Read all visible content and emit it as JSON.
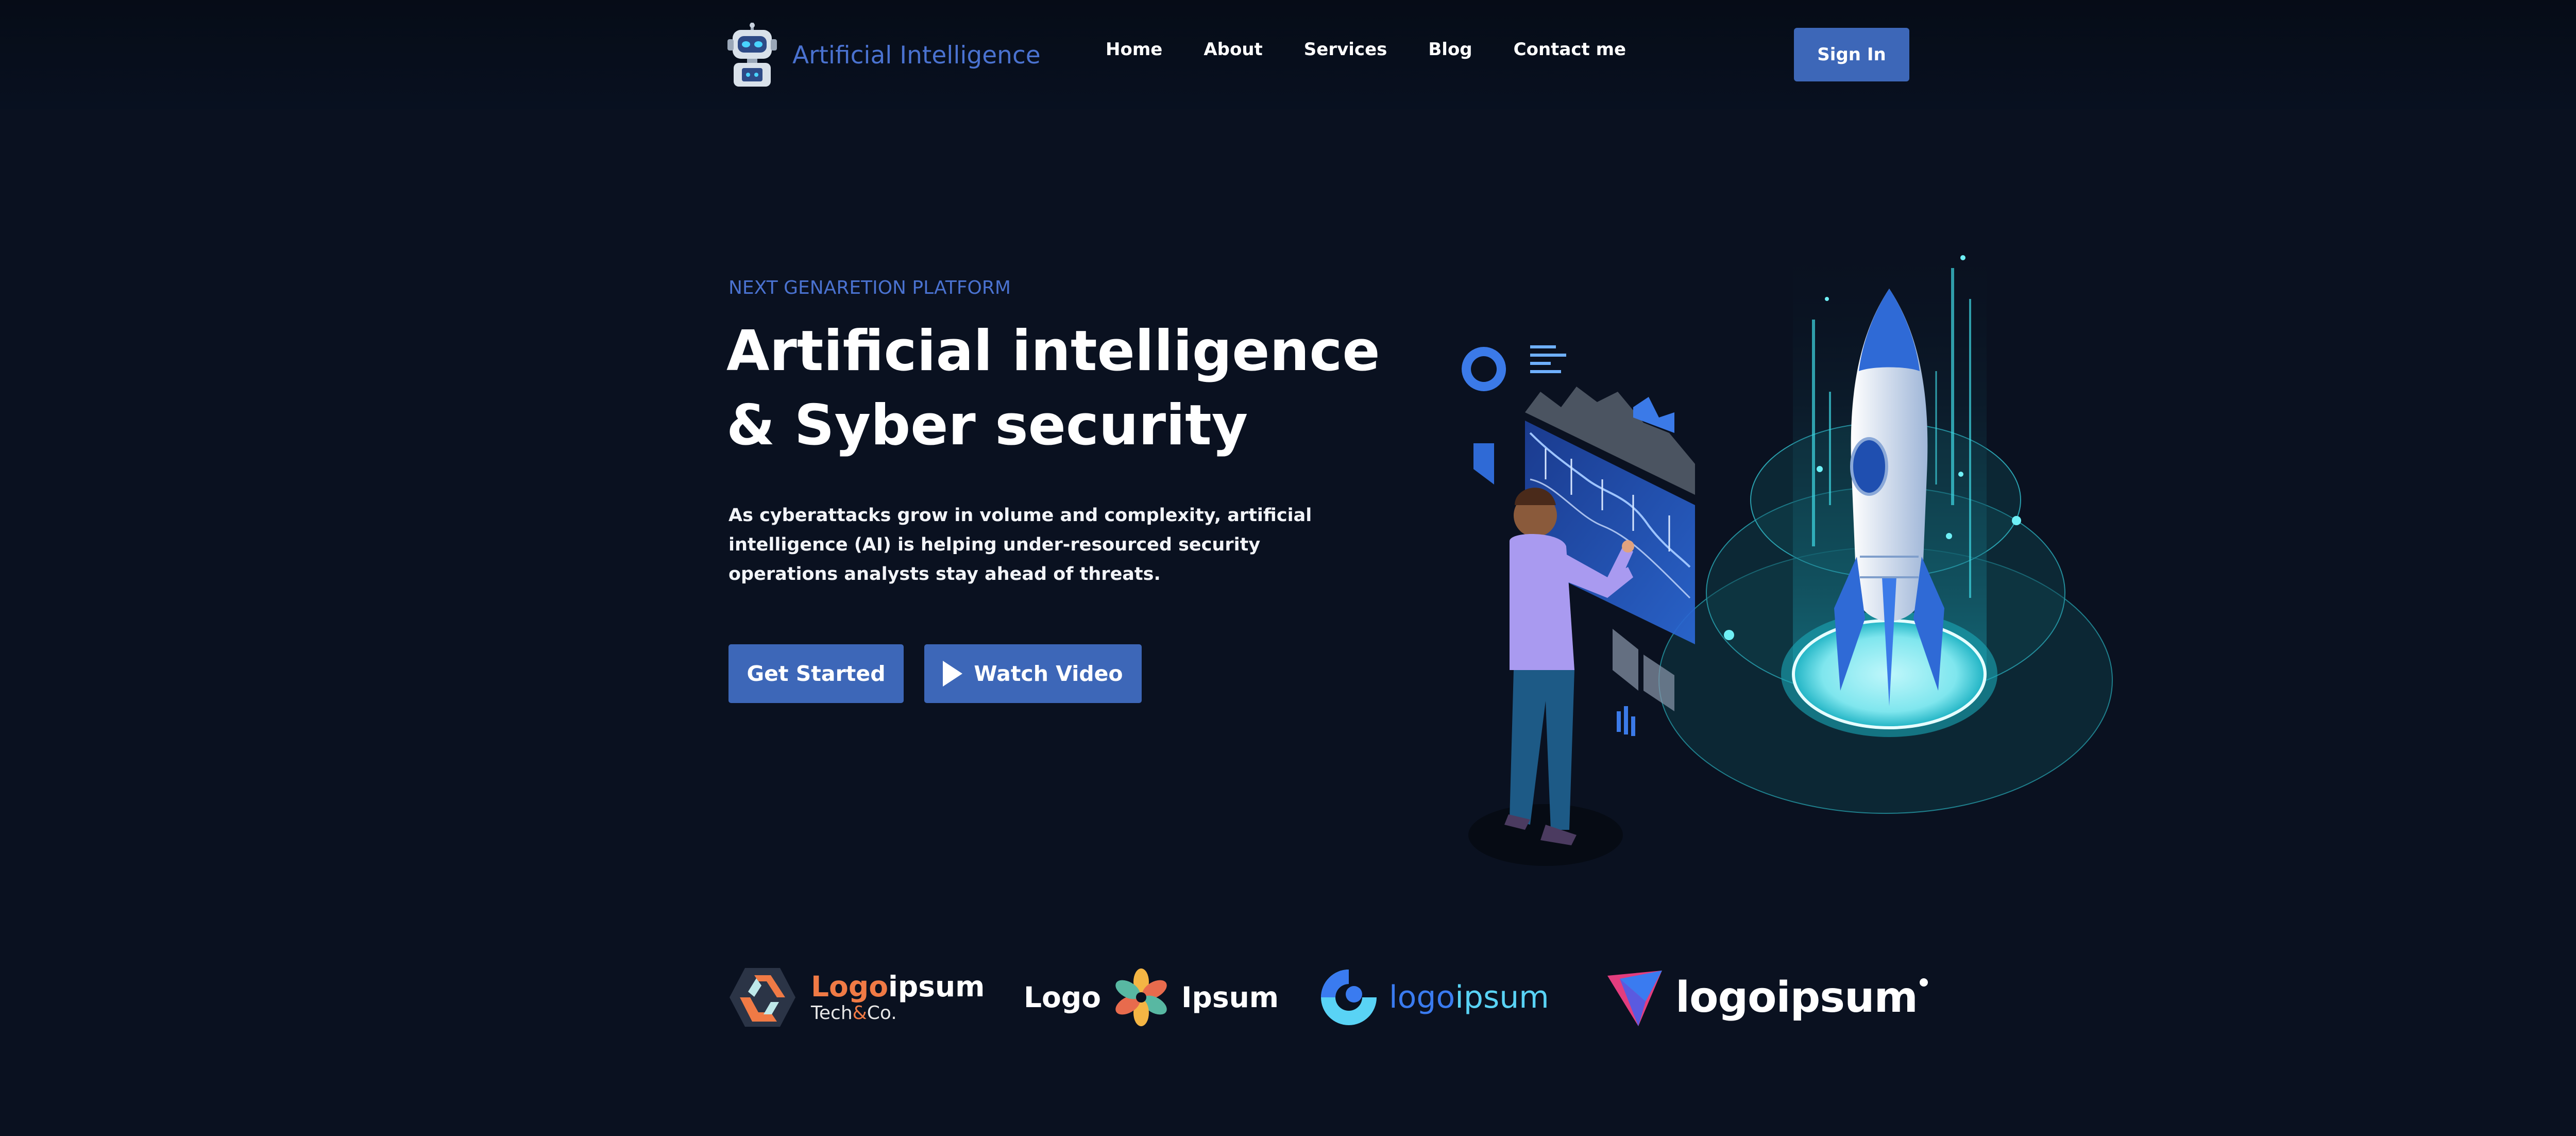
{
  "header": {
    "brand_name": "Artificial Intelligence",
    "brand_icon": "robot-icon",
    "menu": [
      {
        "label": "Home"
      },
      {
        "label": "About"
      },
      {
        "label": "Services"
      },
      {
        "label": "Blog"
      },
      {
        "label": "Contact me"
      }
    ],
    "signin_label": "Sign In"
  },
  "hero": {
    "eyebrow": "NEXT GENARETION PLATFORM",
    "title_line1": "Artificial intelligence",
    "title_line2": "& Syber security",
    "description": "As cyberattacks grow in volume and complexity, artificial intelligence (AI) is helping under-resourced security operations analysts stay ahead of threats.",
    "cta_primary": "Get Started",
    "cta_secondary": "Watch Video",
    "cta_secondary_icon": "play-icon"
  },
  "logos": [
    {
      "part1": "Logo",
      "part2": "ipsum",
      "sub1": "Tech",
      "sub_amp": "&",
      "sub2": "Co."
    },
    {
      "left": "Logo",
      "right": "Ipsum"
    },
    {
      "part1": "logo",
      "part2": "ipsum"
    },
    {
      "text": "logoipsum"
    }
  ],
  "colors": {
    "background": "#0a1120",
    "accent": "#3d67b8",
    "brand_text": "#4a72d0"
  }
}
